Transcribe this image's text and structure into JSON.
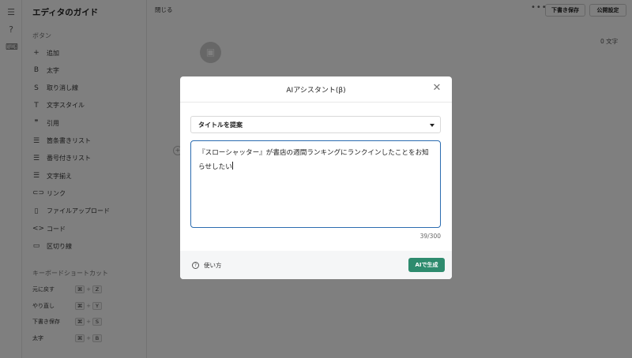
{
  "topbar": {
    "close_label": "閉じる",
    "more": "•••",
    "save_draft_label": "下書き保存",
    "publish_settings_label": "公開設定"
  },
  "editor": {
    "char_count": "0 文字"
  },
  "guide": {
    "title": "エディタのガイド",
    "buttons_section": "ボタン",
    "items": [
      {
        "icon": "plus-icon",
        "glyph": "+",
        "label": "追加"
      },
      {
        "icon": "bold-icon",
        "glyph": "B",
        "label": "太字"
      },
      {
        "icon": "strikethrough-icon",
        "glyph": "S",
        "label": "取り消し線"
      },
      {
        "icon": "text-style-icon",
        "glyph": "T",
        "label": "文字スタイル"
      },
      {
        "icon": "quote-icon",
        "glyph": "❞",
        "label": "引用"
      },
      {
        "icon": "bullet-list-icon",
        "glyph": "☰",
        "label": "箇条書きリスト"
      },
      {
        "icon": "numbered-list-icon",
        "glyph": "☰",
        "label": "番号付きリスト"
      },
      {
        "icon": "align-icon",
        "glyph": "☰",
        "label": "文字揃え"
      },
      {
        "icon": "link-icon",
        "glyph": "⊂⊃",
        "label": "リンク"
      },
      {
        "icon": "file-upload-icon",
        "glyph": "▯",
        "label": "ファイルアップロード"
      },
      {
        "icon": "code-icon",
        "glyph": "<>",
        "label": "コード"
      },
      {
        "icon": "divider-icon",
        "glyph": "▭",
        "label": "区切り線"
      }
    ],
    "shortcuts_section": "キーボードショートカット",
    "shortcuts": [
      {
        "label": "元に戻す",
        "mod": "⌘",
        "key": "Z"
      },
      {
        "label": "やり直し",
        "mod": "⌘",
        "key": "Y"
      },
      {
        "label": "下書き保存",
        "mod": "⌘",
        "key": "S"
      },
      {
        "label": "太字",
        "mod": "⌘",
        "key": "B"
      }
    ]
  },
  "modal": {
    "title": "AIアシスタント(β)",
    "select_value": "タイトルを提案",
    "prompt_text": "『スローシャッター』が書店の週間ランキングにランクインしたことをお知らせしたい",
    "counter": "39/300",
    "help_label": "使い方",
    "generate_label": "AIで生成"
  },
  "colors": {
    "accent_green": "#2e8b6e",
    "focus_blue": "#2b6cb0"
  }
}
